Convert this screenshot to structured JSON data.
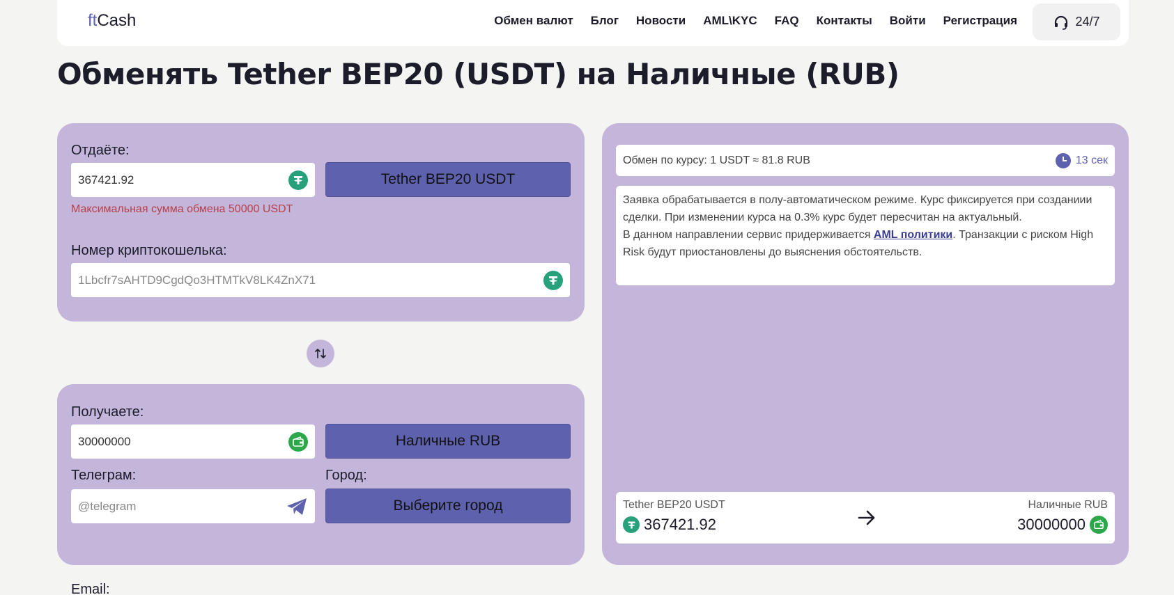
{
  "header": {
    "logo_ft": "ft",
    "logo_cash": "Cash",
    "nav": [
      "Обмен валют",
      "Блог",
      "Новости",
      "AML\\KYC",
      "FAQ",
      "Контакты",
      "Войти",
      "Регистрация"
    ],
    "support": "24/7"
  },
  "page_title": "Обменять Tether BEP20 (USDT) на Наличные (RUB)",
  "give": {
    "label": "Отдаёте:",
    "amount": "367421.92",
    "currency_button": "Tether BEP20 USDT",
    "error": "Максимальная сумма обмена 50000 USDT",
    "wallet_label": "Номер криптокошелька:",
    "wallet_value": "1Lbcfr7sAHTD9CgdQo3HTMTkV8LK4ZnX71"
  },
  "get": {
    "label": "Получаете:",
    "amount": "30000000",
    "currency_button": "Наличные RUB",
    "telegram_label": "Телеграм:",
    "telegram_placeholder": "@telegram",
    "city_label": "Город:",
    "city_button": "Выберите город"
  },
  "email_label": "Email:",
  "rate": {
    "text": "Обмен по курсу: 1 USDT ≈ 81.8 RUB",
    "timer": "13 сек"
  },
  "info": {
    "line1": "Заявка обрабатывается в полу-автоматическом режиме. Курс фиксируется при созданиии сделки. При изменении курса на 0.3% курс будет пересчитан на актуальный.",
    "line2_pre": "В данном направлении сервис придерживается ",
    "line2_link": "AML политики",
    "line2_post": ". Транзакции с риском High Risk будут приостановлены до выяснения обстоятельств."
  },
  "summary": {
    "from_currency": "Tether BEP20 USDT",
    "from_amount": "367421.92",
    "to_currency": "Наличные RUB",
    "to_amount": "30000000"
  },
  "colors": {
    "panel": "#c4b5da",
    "button": "#5e61ae",
    "tether": "#26a17b",
    "cash": "#2ca84a",
    "error": "#b8404a"
  }
}
